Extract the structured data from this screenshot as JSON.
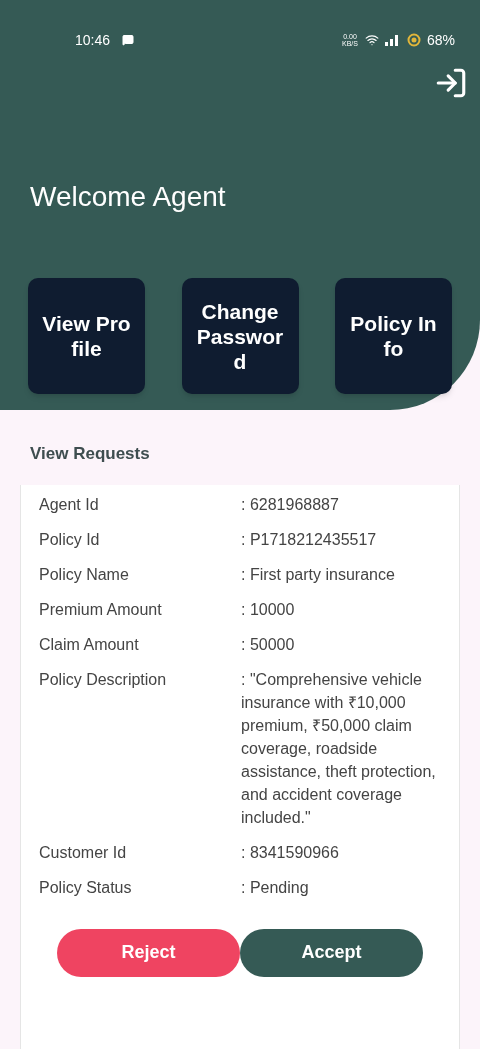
{
  "status_bar": {
    "time": "10:46",
    "network_speed": "0.00 KB/S",
    "battery": "68%"
  },
  "header": {
    "title": "Welcome Agent"
  },
  "quick_actions": [
    {
      "label": "View Profile"
    },
    {
      "label": "Change Password"
    },
    {
      "label": "Policy Info"
    }
  ],
  "section_title": "View Requests",
  "request": {
    "fields": [
      {
        "label": "Agent Id",
        "value": ": 6281968887"
      },
      {
        "label": "Policy Id",
        "value": ": P1718212435517"
      },
      {
        "label": "Policy Name",
        "value": ": First party insurance"
      },
      {
        "label": "Premium Amount",
        "value": ": 10000"
      },
      {
        "label": "Claim Amount",
        "value": ": 50000"
      },
      {
        "label": "Policy Description",
        "value": ": \"Comprehensive vehicle insurance with ₹10,000 premium, ₹50,000 claim coverage, roadside assistance, theft protection, and accident coverage included.\""
      },
      {
        "label": "Customer Id",
        "value": ": 8341590966"
      },
      {
        "label": "Policy Status",
        "value": ": Pending"
      }
    ],
    "actions": [
      {
        "label": "Reject",
        "kind": "reject"
      },
      {
        "label": "Accept",
        "kind": "accept"
      }
    ]
  }
}
